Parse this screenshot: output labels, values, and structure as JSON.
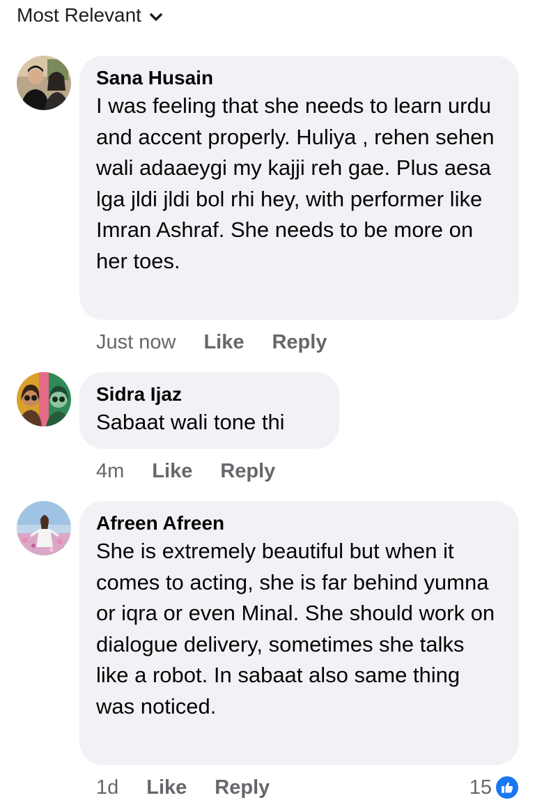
{
  "sort": {
    "label": "Most Relevant"
  },
  "comments": [
    {
      "author": "Sana Husain",
      "text": "I was feeling that she needs to learn urdu and accent properly.  Huliya , rehen sehen wali adaaeygi my kajji reh gae. Plus aesa lga jldi jldi bol rhi hey, with performer like Imran Ashraf. She needs to be more on her toes.",
      "time": "Just now",
      "like_label": "Like",
      "reply_label": "Reply"
    },
    {
      "author": "Sidra Ijaz",
      "text": "Sabaat wali tone thi",
      "time": "4m",
      "like_label": "Like",
      "reply_label": "Reply"
    },
    {
      "author": "Afreen Afreen",
      "text": "She is extremely beautiful but when it comes to acting, she is far behind yumna or iqra or even Minal. She should work on dialogue delivery, sometimes she talks like a robot. In sabaat also same thing was noticed.",
      "time": "1d",
      "like_label": "Like",
      "reply_label": "Reply",
      "reaction_count": "15"
    }
  ],
  "colors": {
    "bubble": "#f0f2f5",
    "meta_text": "#65676b",
    "like_blue": "#1877f2"
  }
}
